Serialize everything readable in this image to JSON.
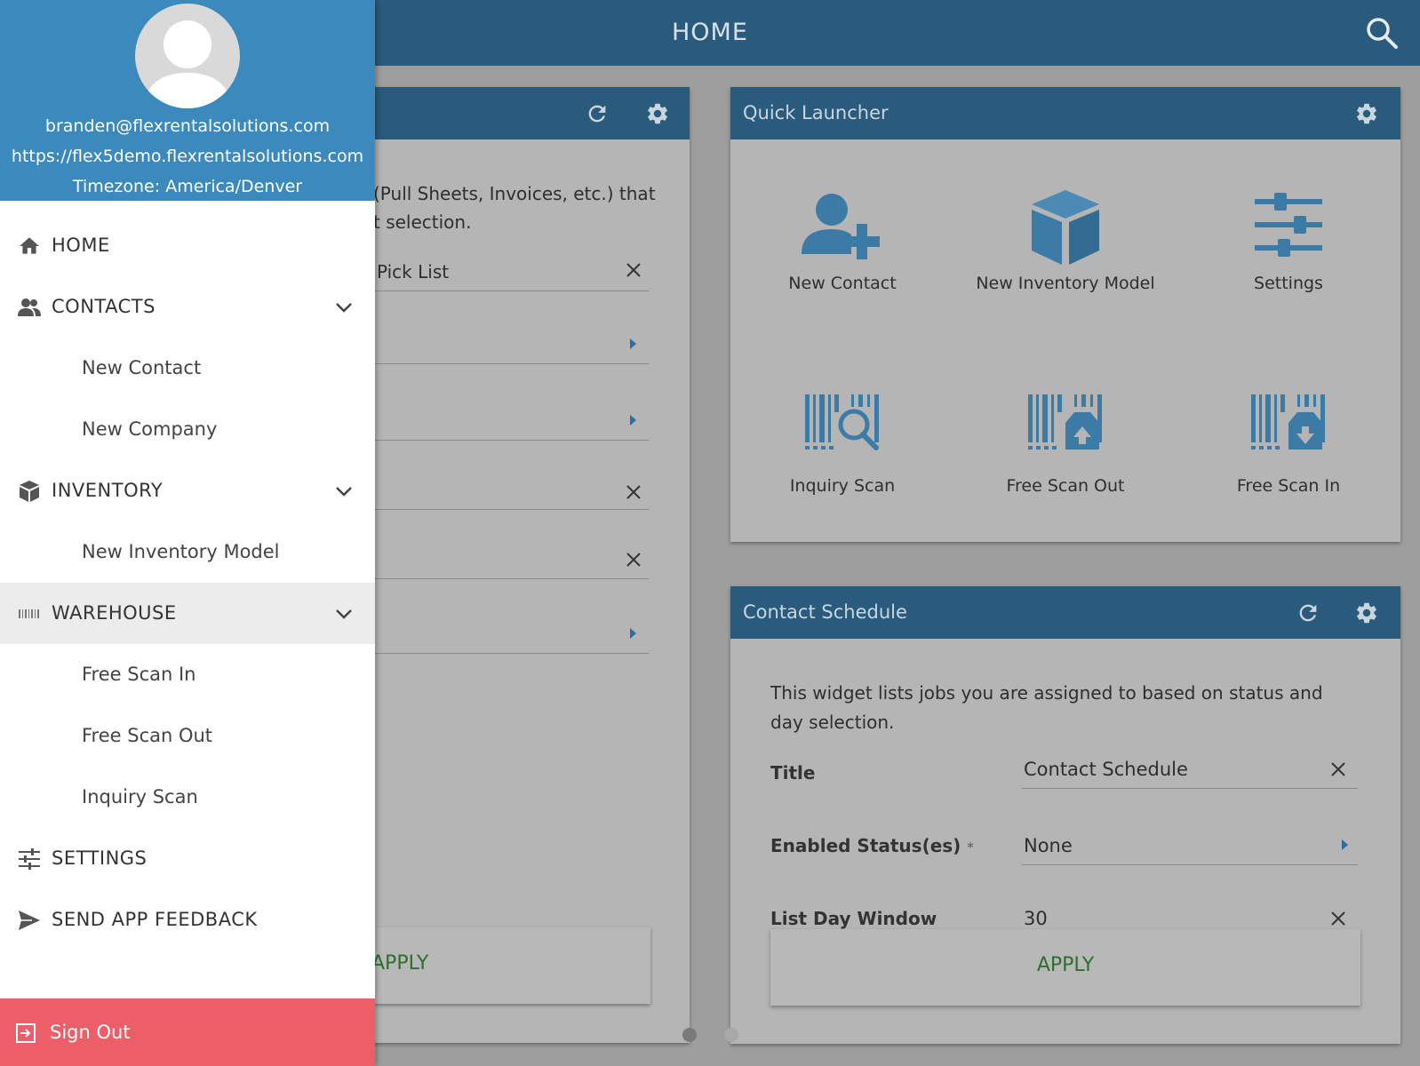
{
  "header": {
    "title": "HOME"
  },
  "left_widget": {
    "description_line1": "(Pull Sheets, Invoices, etc.) that",
    "description_line2": "t selection.",
    "title_value": "Pick List",
    "apply_label": "APPLY"
  },
  "quick_launcher": {
    "title": "Quick Launcher",
    "items": [
      {
        "label": "New Contact",
        "icon": "add-contact-icon"
      },
      {
        "label": "New Inventory Model",
        "icon": "cube-icon"
      },
      {
        "label": "Settings",
        "icon": "sliders-icon"
      },
      {
        "label": "Inquiry Scan",
        "icon": "barcode-search-icon"
      },
      {
        "label": "Free Scan Out",
        "icon": "barcode-upload-icon"
      },
      {
        "label": "Free Scan In",
        "icon": "barcode-download-icon"
      }
    ]
  },
  "contact_schedule": {
    "title": "Contact Schedule",
    "description": "This widget lists jobs you are assigned to based on status and day selection.",
    "fields": [
      {
        "label": "Title",
        "value": "Contact Schedule"
      },
      {
        "label": "Enabled Status(es)",
        "required_mark": "*",
        "value": "None"
      },
      {
        "label": "List Day Window",
        "value": "30"
      }
    ],
    "apply_label": "APPLY"
  },
  "drawer": {
    "email": "branden@flexrentalsolutions.com",
    "server_url": "https://flex5demo.flexrentalsolutions.com",
    "timezone": "Timezone: America/Denver",
    "nav": {
      "home": "HOME",
      "contacts": "CONTACTS",
      "new_contact": "New Contact",
      "new_company": "New Company",
      "inventory": "INVENTORY",
      "new_inventory_model": "New Inventory Model",
      "warehouse": "WAREHOUSE",
      "free_scan_in": "Free Scan In",
      "free_scan_out": "Free Scan Out",
      "inquiry_scan": "Inquiry Scan",
      "settings": "SETTINGS",
      "send_feedback": "SEND APP FEEDBACK"
    },
    "sign_out": "Sign Out"
  },
  "colors": {
    "header_blue": "#2a5b7d",
    "profile_blue": "#3b89bd",
    "sign_out_red": "#ec5f69",
    "apply_green": "#2e6e2e",
    "icon_blue": "#3c7ba6"
  }
}
